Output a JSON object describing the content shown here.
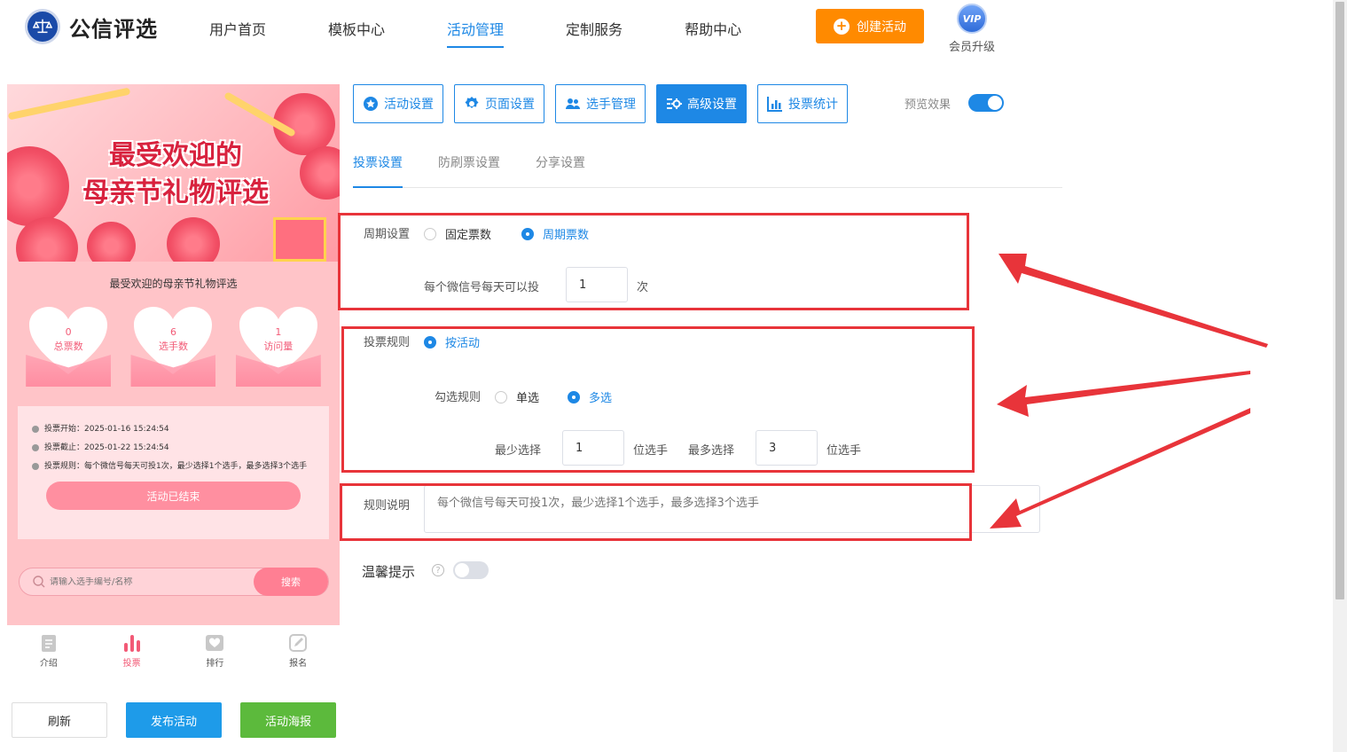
{
  "brand": {
    "name": "公信评选",
    "logo_icon": "scale-icon"
  },
  "nav": [
    {
      "label": "用户首页",
      "active": false
    },
    {
      "label": "模板中心",
      "active": false
    },
    {
      "label": "活动管理",
      "active": true
    },
    {
      "label": "定制服务",
      "active": false
    },
    {
      "label": "帮助中心",
      "active": false
    }
  ],
  "header": {
    "create_label": "创建活动",
    "vip_badge": "VIP",
    "vip_label": "会员升级"
  },
  "preview": {
    "banner_line1": "最受欢迎的",
    "banner_line2": "母亲节礼物评选",
    "title": "最受欢迎的母亲节礼物评选",
    "stats": [
      {
        "value": "0",
        "label": "总票数"
      },
      {
        "value": "6",
        "label": "选手数"
      },
      {
        "value": "1",
        "label": "访问量"
      }
    ],
    "info": [
      {
        "text": "投票开始：2025-01-16 15:24:54"
      },
      {
        "text": "投票截止：2025-01-22 15:24:54"
      },
      {
        "text": "投票规则：每个微信号每天可投1次，最少选择1个选手，最多选择3个选手"
      }
    ],
    "ended_label": "活动已结束",
    "search_placeholder": "请输入选手编号/名称",
    "search_button": "搜索",
    "tabs": [
      {
        "label": "介绍",
        "icon": "document-icon",
        "active": false
      },
      {
        "label": "投票",
        "icon": "bar-chart-icon",
        "active": true
      },
      {
        "label": "排行",
        "icon": "heart-icon",
        "active": false
      },
      {
        "label": "报名",
        "icon": "edit-icon",
        "active": false
      }
    ]
  },
  "actions": {
    "refresh": "刷新",
    "publish": "发布活动",
    "poster": "活动海报"
  },
  "toolbar": {
    "buttons": [
      {
        "label": "活动设置",
        "icon": "star-icon",
        "active": false
      },
      {
        "label": "页面设置",
        "icon": "gear-icon",
        "active": false
      },
      {
        "label": "选手管理",
        "icon": "users-icon",
        "active": false
      },
      {
        "label": "高级设置",
        "icon": "sliders-icon",
        "active": true
      },
      {
        "label": "投票统计",
        "icon": "chart-icon",
        "active": false
      }
    ],
    "preview_label": "预览效果",
    "preview_on": true
  },
  "subtabs": [
    {
      "label": "投票设置",
      "active": true
    },
    {
      "label": "防刷票设置",
      "active": false
    },
    {
      "label": "分享设置",
      "active": false
    }
  ],
  "form": {
    "cycle": {
      "label": "周期设置",
      "options": [
        "固定票数",
        "周期票数"
      ],
      "selected": 1
    },
    "daily": {
      "prefix": "每个微信号每天可以投",
      "value": "1",
      "suffix": "次"
    },
    "rule": {
      "label": "投票规则",
      "option": "按活动"
    },
    "check": {
      "label": "勾选规则",
      "options": [
        "单选",
        "多选"
      ],
      "selected": 1
    },
    "min": {
      "label": "最少选择",
      "value": "1",
      "unit": "位选手"
    },
    "max": {
      "label": "最多选择",
      "value": "3",
      "unit": "位选手"
    },
    "desc": {
      "label": "规则说明",
      "placeholder": "每个微信号每天可投1次，最少选择1个选手，最多选择3个选手"
    },
    "tip": {
      "label": "温馨提示",
      "on": false
    }
  },
  "colors": {
    "accent": "#1e88e5",
    "orange": "#ff8a00",
    "highlight": "#e8343a",
    "green": "#5cba3c"
  }
}
